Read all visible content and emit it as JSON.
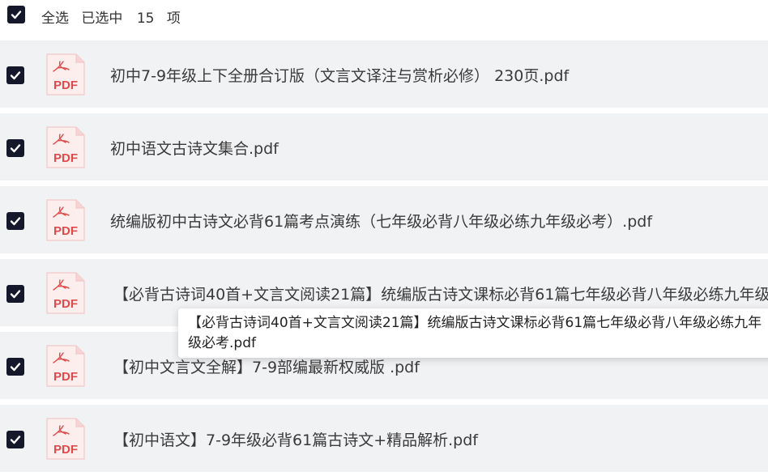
{
  "select_all": {
    "label": "全选",
    "selected_prefix": "已选中",
    "selected_count": "15",
    "selected_suffix": "项"
  },
  "files": [
    {
      "name": "初中7-9年级上下全册合订版（文言文译注与赏析必修） 230页.pdf",
      "checked": true,
      "icon": "pdf-icon"
    },
    {
      "name": "初中语文古诗文集合.pdf",
      "checked": true,
      "icon": "pdf-icon"
    },
    {
      "name": "统编版初中古诗文必背61篇考点演练（七年级必背八年级必练九年级必考）.pdf",
      "checked": true,
      "icon": "pdf-icon"
    },
    {
      "name": "【必背古诗词40首+文言文阅读21篇】统编版古诗文课标必背61篇七年级必背八年级必练九年级必考.pdf",
      "checked": true,
      "icon": "pdf-icon"
    },
    {
      "name": "【初中文言文全解】7-9部编最新权威版 .pdf",
      "checked": true,
      "icon": "pdf-icon"
    },
    {
      "name": "【初中语文】7-9年级必背61篇古诗文+精品解析.pdf",
      "checked": true,
      "icon": "pdf-icon"
    }
  ],
  "tooltip": {
    "text": "【必背古诗词40首+文言文阅读21篇】统编版古诗文课标必背61篇七年级必背八年级必练九年级必考.pdf"
  },
  "colors": {
    "checkbox_bg": "#15172b",
    "row_bg": "#f1f2f4",
    "pdf_accent": "#e04a4a"
  }
}
